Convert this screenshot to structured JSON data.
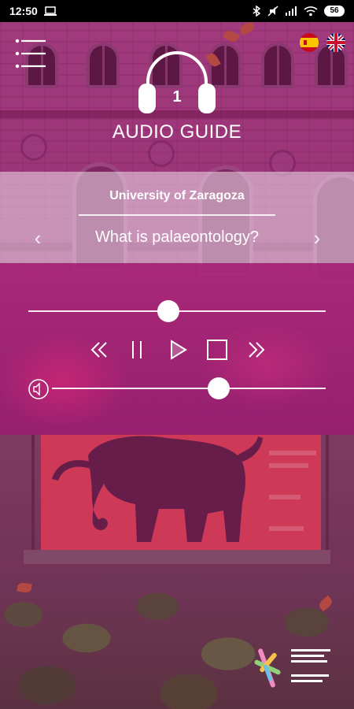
{
  "status_bar": {
    "time": "12:50",
    "battery": "56"
  },
  "header": {
    "menu_icon": "hamburger-menu-icon",
    "logo_icon": "headphones-icon",
    "guide_number": "1",
    "title": "AUDIO GUIDE",
    "languages": [
      {
        "code": "es",
        "icon": "spain-flag-icon"
      },
      {
        "code": "en",
        "icon": "uk-flag-icon"
      }
    ]
  },
  "track": {
    "location": "University of Zaragoza",
    "title": "What is palaeontology?",
    "prev_symbol": "‹",
    "next_symbol": "›"
  },
  "player": {
    "progress": 0.47,
    "volume": 0.61,
    "buttons": [
      "rewind",
      "pause",
      "play",
      "stop",
      "fast-forward"
    ]
  },
  "colors": {
    "accent": "#b0237a",
    "panel": "#f0e1ee",
    "poster": "#d8444a"
  }
}
